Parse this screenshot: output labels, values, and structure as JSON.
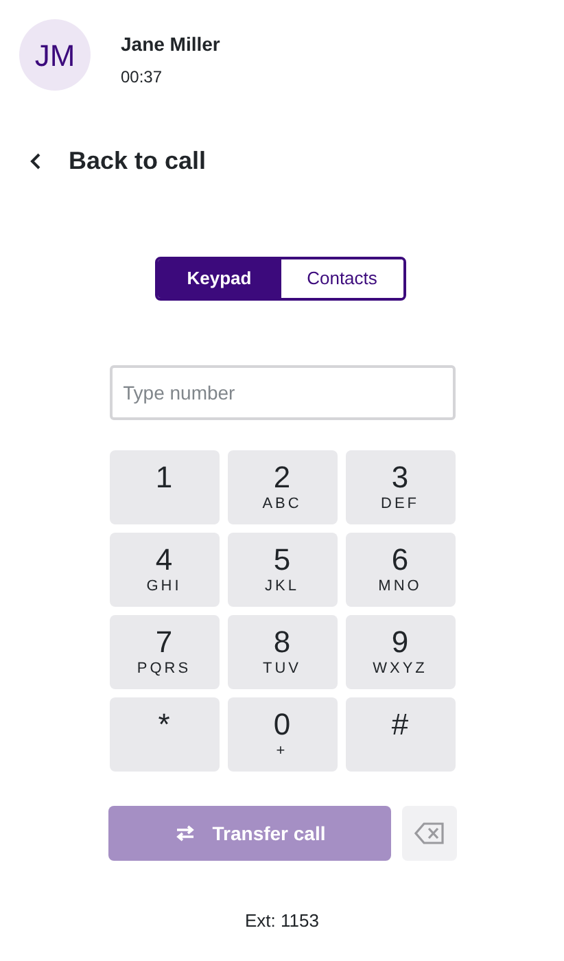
{
  "caller": {
    "initials": "JM",
    "name": "Jane Miller",
    "duration": "00:37"
  },
  "back": {
    "label": "Back to call"
  },
  "tabs": [
    {
      "label": "Keypad",
      "selected": true
    },
    {
      "label": "Contacts",
      "selected": false
    }
  ],
  "number_field": {
    "placeholder": "Type number"
  },
  "keys": [
    {
      "digit": "1"
    },
    {
      "digit": "2",
      "letters": "ABC"
    },
    {
      "digit": "3",
      "letters": "DEF"
    },
    {
      "digit": "4",
      "letters": "GHI"
    },
    {
      "digit": "5",
      "letters": "JKL"
    },
    {
      "digit": "6",
      "letters": "MNO"
    },
    {
      "digit": "7",
      "letters": "PQRS"
    },
    {
      "digit": "8",
      "letters": "TUV"
    },
    {
      "digit": "9",
      "letters": "WXYZ"
    },
    {
      "digit": "*"
    },
    {
      "digit": "0",
      "letters": "+"
    },
    {
      "digit": "#"
    }
  ],
  "transfer_button": {
    "label": "Transfer call",
    "disabled": true
  },
  "extension": "Ext: 1153"
}
